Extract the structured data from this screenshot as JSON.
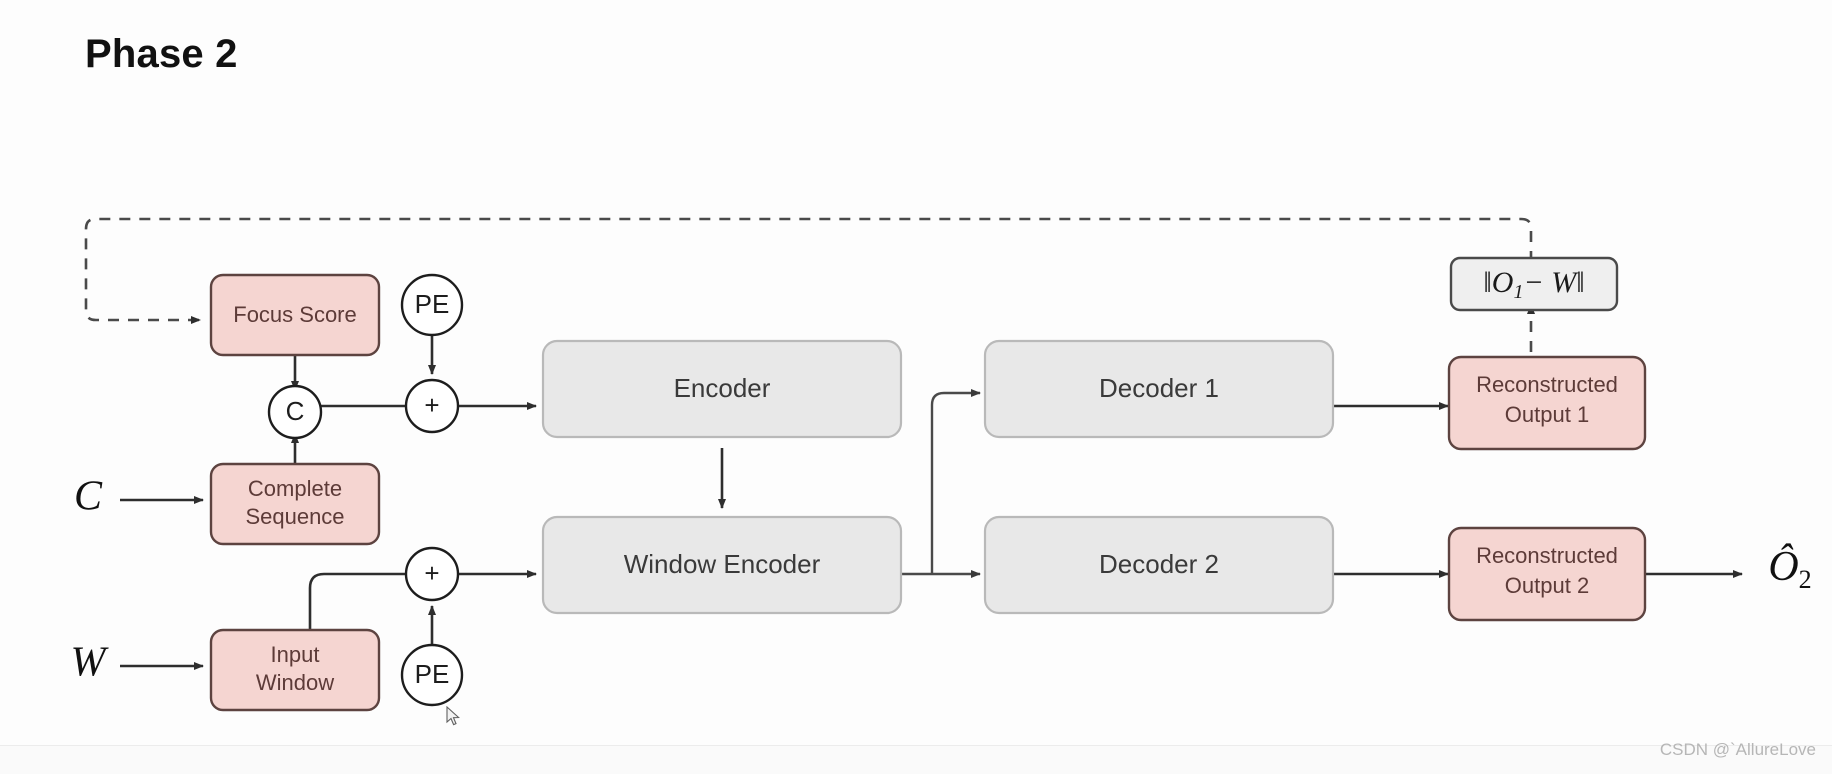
{
  "title": "Phase 2",
  "watermark": "CSDN @`AllureLove",
  "inputs": {
    "complete_sequence_symbol": "C",
    "input_window_symbol": "W"
  },
  "outputs": {
    "final_symbol": "Ô",
    "final_subscript": "2"
  },
  "nodes": {
    "focus_score": {
      "label": "Focus Score",
      "color": "#f5d5d1"
    },
    "complete_sequence": {
      "line1": "Complete",
      "line2": "Sequence",
      "color": "#f5d5d1"
    },
    "input_window": {
      "line1": "Input",
      "line2": "Window",
      "color": "#f5d5d1"
    },
    "encoder": {
      "label": "Encoder",
      "color": "#e8e8e8"
    },
    "window_encoder": {
      "label": "Window Encoder",
      "color": "#e8e8e8"
    },
    "decoder_1": {
      "label": "Decoder 1",
      "color": "#e8e8e8"
    },
    "decoder_2": {
      "label": "Decoder 2",
      "color": "#e8e8e8"
    },
    "reconstructed_output_1": {
      "line1": "Reconstructed",
      "line2": "Output 1",
      "color": "#f5d5d1"
    },
    "reconstructed_output_2": {
      "line1": "Reconstructed",
      "line2": "Output 2",
      "color": "#f5d5d1"
    },
    "loss_box": {
      "label": "‖O",
      "subscript": "1",
      "operator": "− W‖",
      "color": "#efefef"
    }
  },
  "operators": {
    "pe_top": "PE",
    "pe_bottom": "PE",
    "concat": "C",
    "add_top": "+",
    "add_bottom": "+"
  },
  "edges": {
    "feedback_label": "dashed feedback from loss to focus score"
  }
}
